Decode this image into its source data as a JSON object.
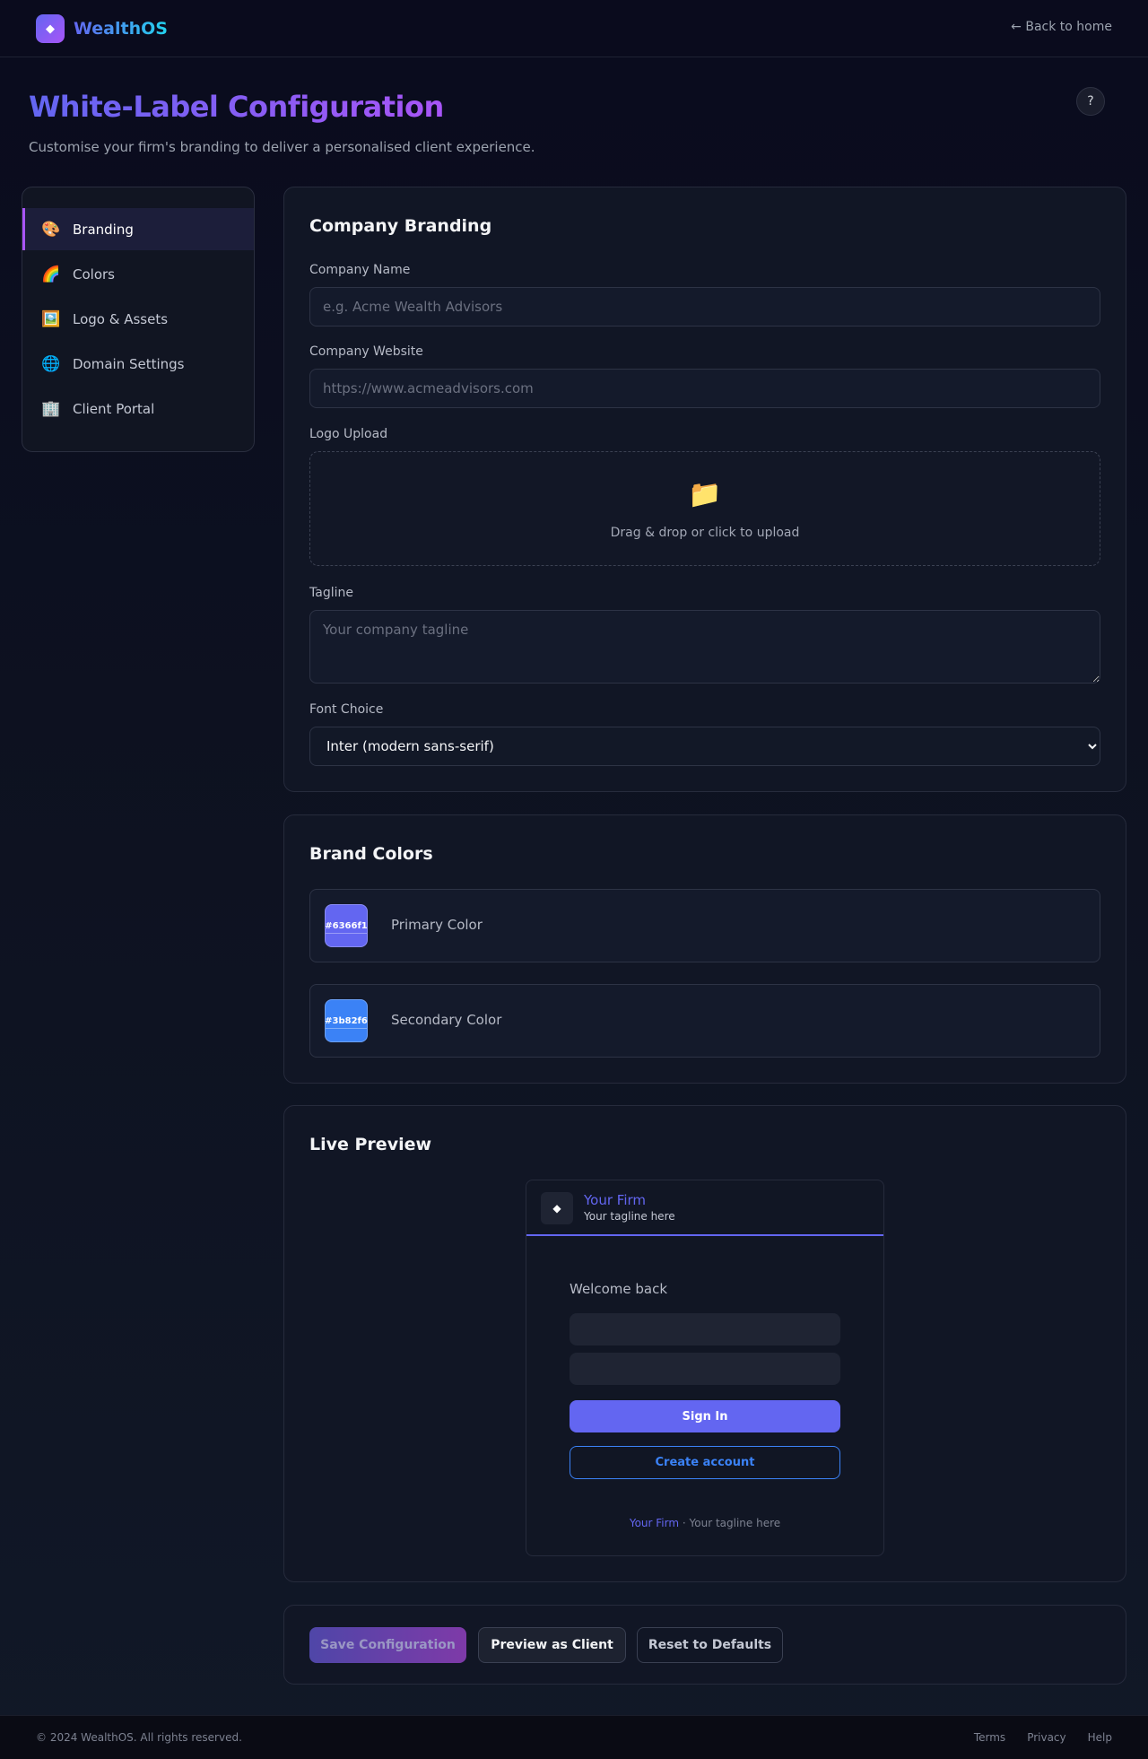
{
  "app": {
    "brand_icon": "◆",
    "brand_name": "WealthOS",
    "back_link": "← Back to home"
  },
  "page": {
    "title": "White-Label Configuration",
    "subtitle": "Customise your firm's branding to deliver a personalised client experience.",
    "help_label": "?"
  },
  "sidebar": {
    "items": [
      {
        "icon": "🎨",
        "label": "Branding",
        "active": true
      },
      {
        "icon": "🌈",
        "label": "Colors"
      },
      {
        "icon": "🖼️",
        "label": "Logo & Assets"
      },
      {
        "icon": "🌐",
        "label": "Domain Settings"
      },
      {
        "icon": "🏢",
        "label": "Client Portal"
      }
    ]
  },
  "branding": {
    "title": "Company Branding",
    "company_name_label": "Company Name",
    "company_name_value": "",
    "company_name_placeholder": "e.g. Acme Wealth Advisors",
    "website_label": "Company Website",
    "website_value": "",
    "website_placeholder": "https://www.acmeadvisors.com",
    "logo_label": "Logo Upload",
    "logo_icon": "📁",
    "logo_text": "Drag & drop or click to upload",
    "tagline_label": "Tagline",
    "tagline_value": "",
    "tagline_placeholder": "Your company tagline",
    "font_label": "Font Choice",
    "font_selected": "Inter (modern sans-serif)"
  },
  "colors": {
    "title": "Brand Colors",
    "primary": {
      "label": "Primary Color",
      "hex": "#6366f1"
    },
    "secondary": {
      "label": "Secondary Color",
      "hex": "#3b82f6"
    }
  },
  "preview": {
    "title": "Live Preview",
    "logo_icon": "◆",
    "firm_name": "Your Firm",
    "tagline": "Your tagline here",
    "welcome": "Welcome back",
    "signin_label": "Sign In",
    "create_label": "Create account",
    "footer_firm": "Your Firm",
    "footer_sep": " · ",
    "footer_tagline": "Your tagline here"
  },
  "actions": {
    "save_label": "Save Configuration",
    "preview_label": "Preview as Client",
    "reset_label": "Reset to Defaults"
  },
  "footer": {
    "copyright": "© 2024 WealthOS. All rights reserved.",
    "links": [
      "Terms",
      "Privacy",
      "Help"
    ]
  }
}
